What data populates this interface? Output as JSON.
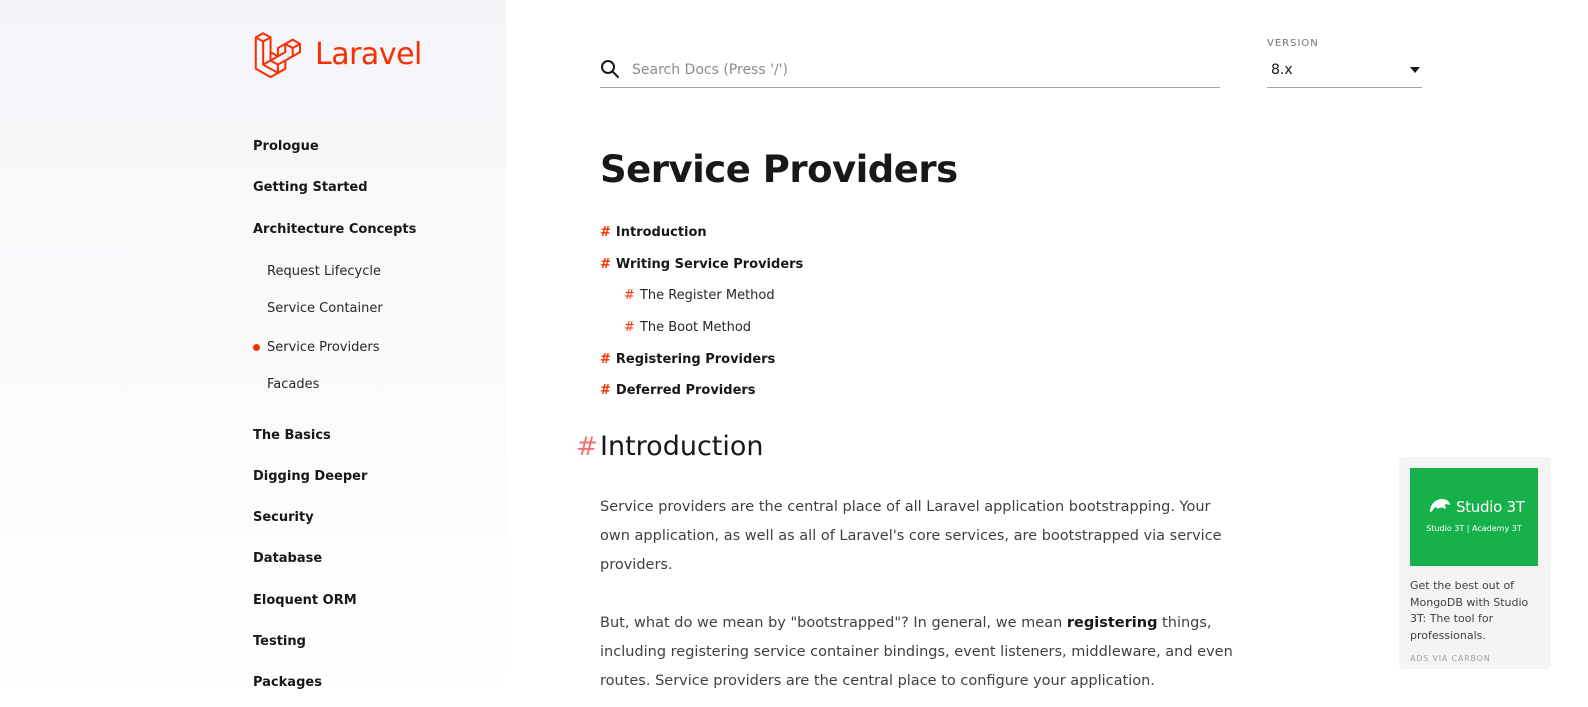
{
  "brand": {
    "name": "Laravel",
    "logo_icon": "laravel-logo-icon",
    "color": "#f53003"
  },
  "sidebar": {
    "items": [
      {
        "label": "Prologue"
      },
      {
        "label": "Getting Started"
      },
      {
        "label": "Architecture Concepts"
      },
      {
        "label": "The Basics"
      },
      {
        "label": "Digging Deeper"
      },
      {
        "label": "Security"
      },
      {
        "label": "Database"
      },
      {
        "label": "Eloquent ORM"
      },
      {
        "label": "Testing"
      },
      {
        "label": "Packages"
      }
    ],
    "subitems": [
      {
        "label": "Request Lifecycle",
        "active": false
      },
      {
        "label": "Service Container",
        "active": false
      },
      {
        "label": "Service Providers",
        "active": true
      },
      {
        "label": "Facades",
        "active": false
      }
    ]
  },
  "search": {
    "placeholder": "Search Docs (Press '/')",
    "value": "",
    "icon": "search-icon"
  },
  "version": {
    "label": "VERSION",
    "value": "8.x"
  },
  "page": {
    "title": "Service Providers",
    "toc": [
      {
        "label": "Introduction",
        "level": 1
      },
      {
        "label": "Writing Service Providers",
        "level": 1
      },
      {
        "label": "The Register Method",
        "level": 2
      },
      {
        "label": "The Boot Method",
        "level": 2
      },
      {
        "label": "Registering Providers",
        "level": 1
      },
      {
        "label": "Deferred Providers",
        "level": 1
      }
    ],
    "hash": "#",
    "section_title": "Introduction",
    "para1": "Service providers are the central place of all Laravel application bootstrapping. Your own application, as well as all of Laravel's core services, are bootstrapped via service providers.",
    "para2_before": "But, what do we mean by \"bootstrapped\"? In general, we mean ",
    "para2_bold": "registering",
    "para2_after": " things, including registering service container bindings, event listeners, middleware, and even routes. Service providers are the central place to configure your application."
  },
  "ad": {
    "brand": "Studio 3T",
    "subtitle": "Studio 3T | Academy 3T",
    "text": "Get the best out of MongoDB with Studio 3T: The tool for professionals.",
    "via": "ADS VIA CARBON",
    "color": "#16b14a"
  }
}
